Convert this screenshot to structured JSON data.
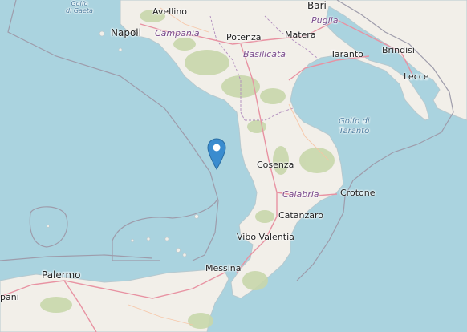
{
  "map": {
    "regions": {
      "campania": "Campania",
      "puglia": "Puglia",
      "basilicata": "Basilicata",
      "calabria": "Calabria"
    },
    "water": {
      "golfo_gaeta": [
        "Golfo",
        "di Gaeta"
      ],
      "golfo_taranto": [
        "Golfo di",
        "Taranto"
      ]
    },
    "cities": {
      "bari": "Bari",
      "avellino": "Avellino",
      "napoli": "Napoli",
      "potenza": "Potenza",
      "matera": "Matera",
      "brindisi": "Brindisi",
      "taranto": "Taranto",
      "lecce": "Lecce",
      "cosenza": "Cosenza",
      "crotone": "Crotone",
      "catanzaro": "Catanzaro",
      "vibo": "Vibo Valentia",
      "messina": "Messina",
      "palermo": "Palermo",
      "trapani_partial": "pani"
    },
    "marker": {
      "icon": "map-pin-icon",
      "color": "#3a8ccf"
    },
    "colors": {
      "sea": "#aad3df",
      "land": "#f2efe9",
      "forest": "#c8d7ab",
      "road": "#e892a2",
      "border": "#9e9cab"
    }
  }
}
